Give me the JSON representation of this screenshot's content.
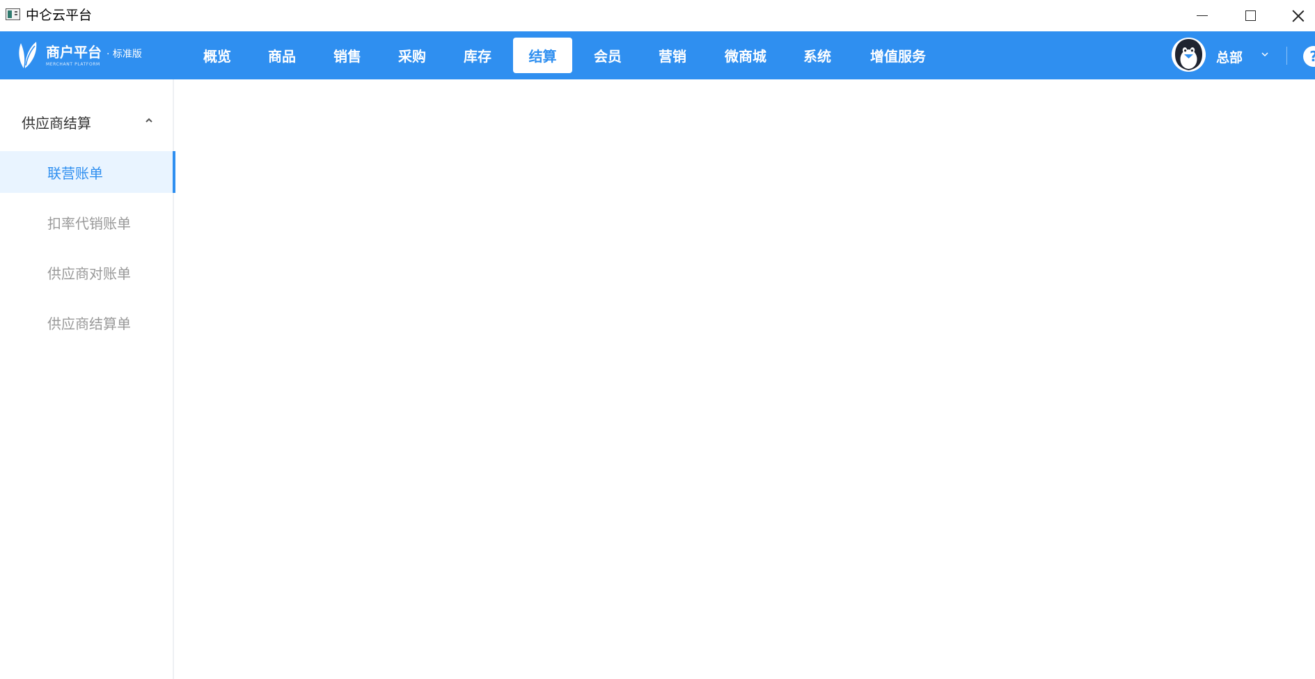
{
  "window": {
    "title": "中仑云平台",
    "icon": "app-window-icon",
    "controls": [
      "minimize-icon",
      "maximize-icon",
      "close-icon"
    ]
  },
  "topnav": {
    "background": "#2f8ff0",
    "logo": {
      "title": "商户平台",
      "edition": "· 标准版",
      "subtitle": "MERCHANT PLATFORM"
    },
    "items": [
      {
        "label": "概览"
      },
      {
        "label": "商品"
      },
      {
        "label": "销售"
      },
      {
        "label": "采购"
      },
      {
        "label": "库存"
      },
      {
        "label": "结算",
        "active": true
      },
      {
        "label": "会员"
      },
      {
        "label": "营销"
      },
      {
        "label": "微商城"
      },
      {
        "label": "系统"
      },
      {
        "label": "增值服务"
      }
    ],
    "user": {
      "name": "总部",
      "avatar": "penguin-avatar"
    },
    "help_icon": "?"
  },
  "sidebar": {
    "group": {
      "title": "供应商结算",
      "expanded": true
    },
    "items": [
      {
        "label": "联营账单",
        "active": true
      },
      {
        "label": "扣率代销账单"
      },
      {
        "label": "供应商对账单"
      },
      {
        "label": "供应商结算单"
      }
    ]
  }
}
